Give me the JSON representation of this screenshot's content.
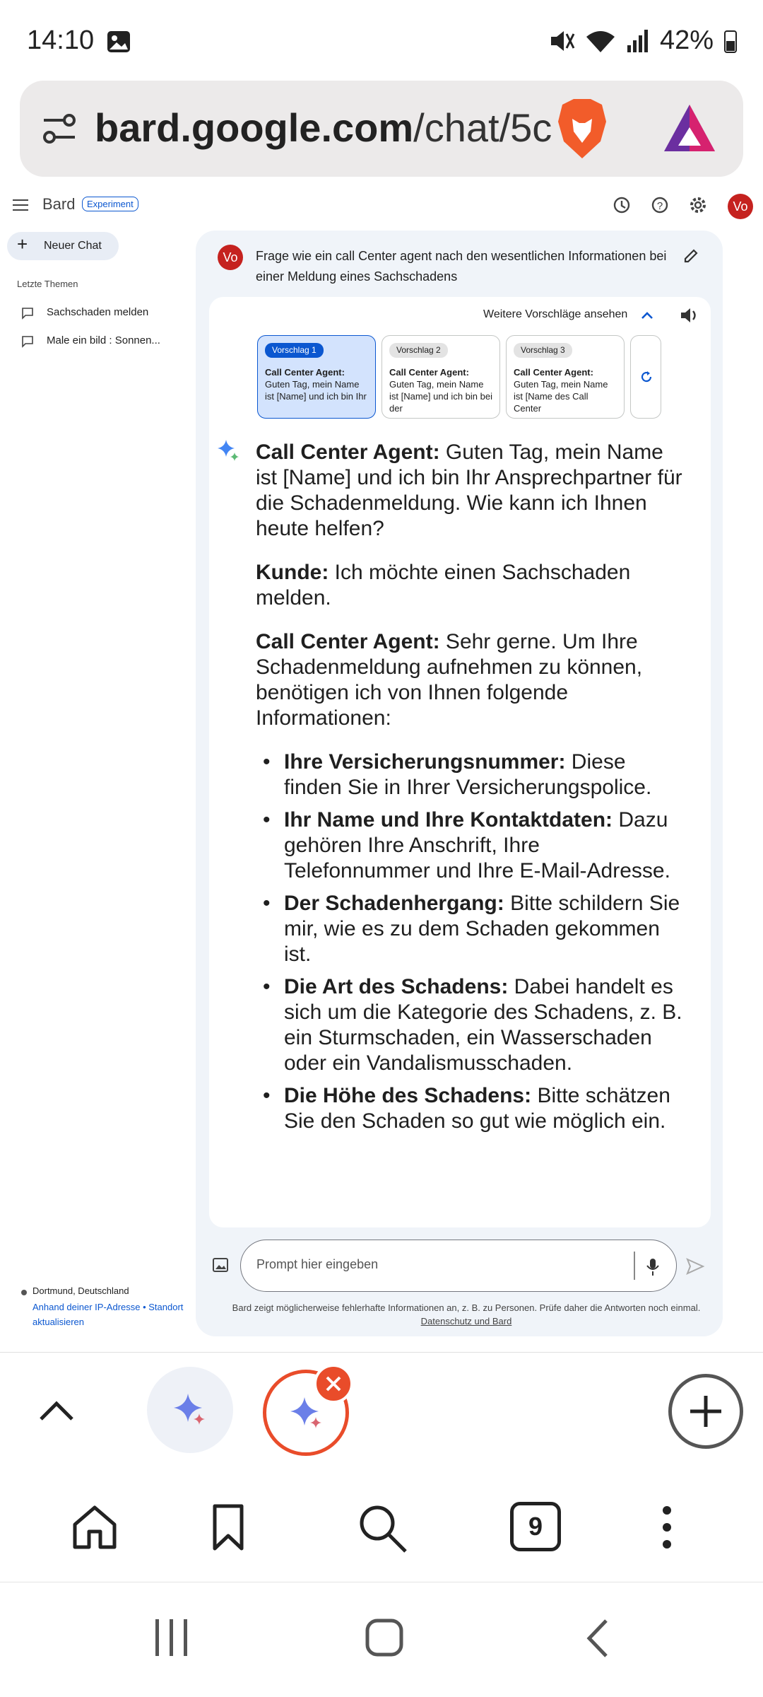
{
  "status_bar": {
    "time": "14:10",
    "battery": "42%",
    "icons": [
      "image-icon",
      "mute-icon",
      "wifi-icon",
      "signal-icon",
      "battery-icon"
    ]
  },
  "url_bar": {
    "url_host": "bard.google.com",
    "url_path": "/chat/5c"
  },
  "header": {
    "app_name": "Bard",
    "badge": "Experiment",
    "avatar": "Vo"
  },
  "sidebar": {
    "new_chat_label": "Neuer Chat",
    "section_title": "Letzte Themen",
    "items": [
      {
        "label": "Sachschaden melden"
      },
      {
        "label": "Male ein bild : Sonnen..."
      }
    ],
    "location": {
      "place": "Dortmund, Deutschland",
      "link": "Anhand deiner IP-Adresse • Standort aktualisieren"
    }
  },
  "chat": {
    "user_avatar": "Vo",
    "user_query": "Frage wie ein call Center agent nach den wesentlichen Informationen bei einer Meldung eines Sachschadens",
    "more_drafts_label": "Weitere Vorschläge ansehen",
    "drafts": [
      {
        "label": "Vorschlag 1",
        "text": "Call Center Agent:",
        "rest": "Guten Tag, mein Name ist [Name] und ich bin Ihr"
      },
      {
        "label": "Vorschlag 2",
        "text": "Call Center Agent:",
        "rest": "Guten Tag, mein Name ist [Name] und ich bin bei der"
      },
      {
        "label": "Vorschlag 3",
        "text": "Call Center Agent:",
        "rest": "Guten Tag, mein Name ist [Name des Call Center"
      }
    ],
    "answer": {
      "p1_bold": "Call Center Agent:",
      "p1": " Guten Tag, mein Name ist [Name] und ich bin Ihr Ansprechpartner für die Schadenmeldung. Wie kann ich Ihnen heute helfen?",
      "p2_bold": "Kunde:",
      "p2": " Ich möchte einen Sachschaden melden.",
      "p3_bold": "Call Center Agent:",
      "p3": " Sehr gerne. Um Ihre Schadenmeldung aufnehmen zu können, benötigen ich von Ihnen folgende Informationen:",
      "list": [
        {
          "bold": "Ihre Versicherungsnummer:",
          "text": " Diese finden Sie in Ihrer Versicherungspolice."
        },
        {
          "bold": "Ihr Name und Ihre Kontaktdaten:",
          "text": " Dazu gehören Ihre Anschrift, Ihre Telefonnummer und Ihre E-Mail-Adresse."
        },
        {
          "bold": "Der Schadenhergang:",
          "text": " Bitte schildern Sie mir, wie es zu dem Schaden gekommen ist."
        },
        {
          "bold": "Die Art des Schadens:",
          "text": " Dabei handelt es sich um die Kategorie des Schadens, z. B. ein Sturmschaden, ein Wasserschaden oder ein Vandalismusschaden."
        },
        {
          "bold": "Die Höhe des Schadens:",
          "text": " Bitte schätzen Sie den Schaden so gut wie möglich ein."
        }
      ]
    },
    "prompt_placeholder": "Prompt hier eingeben",
    "disclaimer": "Bard zeigt möglicherweise fehlerhafte Informationen an, z. B. zu Personen. Prüfe daher die Antworten noch einmal.",
    "privacy_link": "Datenschutz und Bard"
  },
  "browser": {
    "tab_count": "9"
  },
  "colors": {
    "accent": "#0b57d0",
    "avatar": "#c5221f",
    "brave": "#f25c2a"
  }
}
